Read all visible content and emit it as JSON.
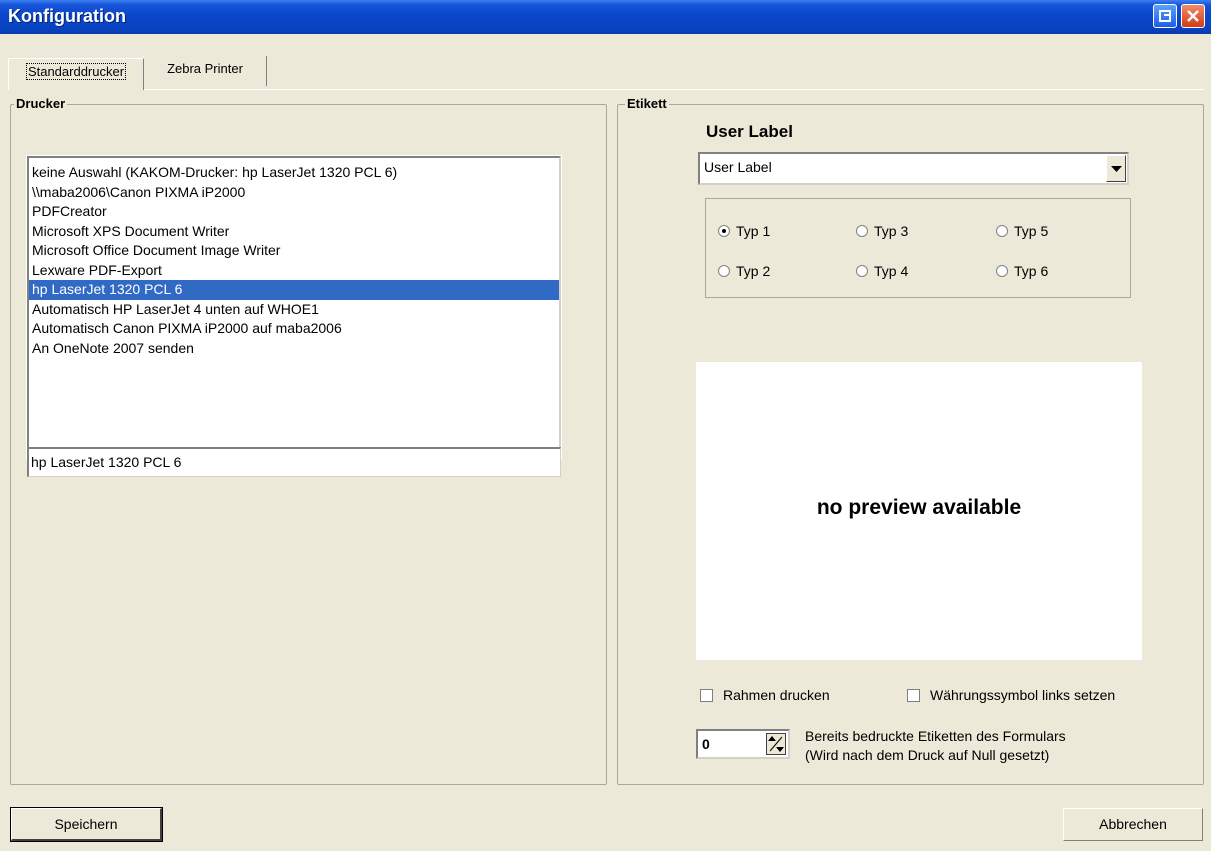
{
  "window": {
    "title": "Konfiguration"
  },
  "tabs": [
    {
      "label": "Standarddrucker"
    },
    {
      "label": "Zebra Printer"
    }
  ],
  "drucker": {
    "group_label": "Drucker",
    "printers": [
      "keine Auswahl (KAKOM-Drucker: hp LaserJet 1320 PCL 6)",
      "\\\\maba2006\\Canon PIXMA iP2000",
      "PDFCreator",
      "Microsoft XPS Document Writer",
      "Microsoft Office Document Image Writer",
      "Lexware PDF-Export",
      "hp LaserJet 1320 PCL 6",
      "Automatisch HP LaserJet 4 unten auf WHOE1",
      "Automatisch Canon PIXMA iP2000 auf maba2006",
      "An OneNote 2007 senden"
    ],
    "selected_index": 6,
    "selected_printer_field": "hp LaserJet 1320 PCL 6"
  },
  "etikett": {
    "group_label": "Etikett",
    "label_heading": "User Label",
    "label_select_value": "User Label",
    "types": [
      {
        "label": "Typ 1",
        "checked": true
      },
      {
        "label": "Typ 2",
        "checked": false
      },
      {
        "label": "Typ 3",
        "checked": false
      },
      {
        "label": "Typ 4",
        "checked": false
      },
      {
        "label": "Typ 5",
        "checked": false
      },
      {
        "label": "Typ 6",
        "checked": false
      }
    ],
    "preview_text": "no preview available",
    "checkboxes": {
      "rahmen": {
        "label": "Rahmen drucken",
        "checked": false
      },
      "waehrung": {
        "label": "Währungssymbol links setzen",
        "checked": false
      }
    },
    "printed_count": "0",
    "printed_count_text_line1": "Bereits bedruckte Etiketten des Formulars",
    "printed_count_text_line2": "(Wird nach dem Druck auf Null gesetzt)"
  },
  "buttons": {
    "save": "Speichern",
    "cancel": "Abbrechen"
  },
  "colors": {
    "titlebar": "#0a45c8",
    "selection": "#316ac5",
    "dialog_bg": "#ece9d8"
  }
}
